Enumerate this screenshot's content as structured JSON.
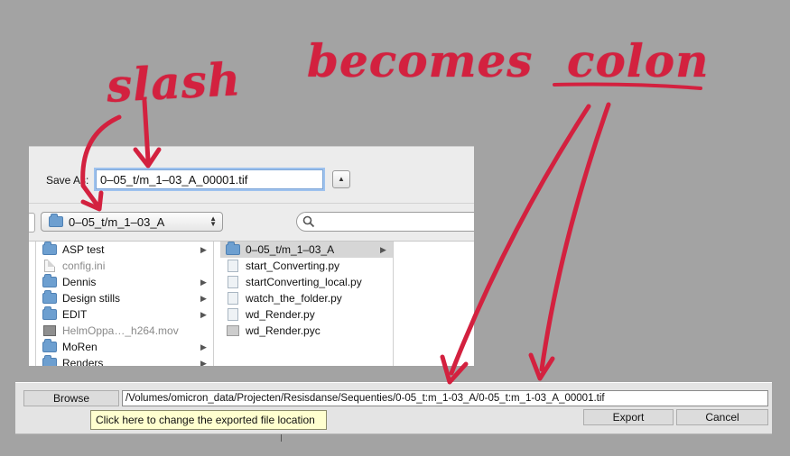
{
  "annotation": {
    "words": [
      "slash",
      "becomes",
      "colon"
    ],
    "color": "#d3213f"
  },
  "save_dialog": {
    "save_as_label": "Save As:",
    "filename_value": "0–05_t/m_1–03_A_00001.tif",
    "expand_button_glyph": "▲",
    "path_popup_label": "0–05_t/m_1–03_A",
    "popup_arrows": "▲▼",
    "search_icon": "magnifier-icon",
    "column_left": [
      {
        "name": "ASP test",
        "kind": "folder",
        "has_children": true
      },
      {
        "name": "config.ini",
        "kind": "file",
        "has_children": false,
        "dim": true
      },
      {
        "name": "Dennis",
        "kind": "folder",
        "has_children": true
      },
      {
        "name": "Design stills",
        "kind": "folder",
        "has_children": true
      },
      {
        "name": "EDIT",
        "kind": "folder",
        "has_children": true
      },
      {
        "name": "HelmOppa…_h264.mov",
        "kind": "media",
        "has_children": false,
        "dim": true
      },
      {
        "name": "MoRen",
        "kind": "folder",
        "has_children": true
      },
      {
        "name": "Renders",
        "kind": "folder",
        "has_children": true
      }
    ],
    "column_mid": [
      {
        "name": "0–05_t/m_1–03_A",
        "kind": "folder",
        "has_children": true,
        "selected": true
      },
      {
        "name": "start_Converting.py",
        "kind": "py",
        "has_children": false
      },
      {
        "name": "startConverting_local.py",
        "kind": "py",
        "has_children": false
      },
      {
        "name": "watch_the_folder.py",
        "kind": "py",
        "has_children": false
      },
      {
        "name": "wd_Render.py",
        "kind": "py",
        "has_children": false
      },
      {
        "name": "wd_Render.pyc",
        "kind": "pyc",
        "has_children": false
      }
    ],
    "chevron_glyph": "▶"
  },
  "export_panel": {
    "browse_label": "Browse",
    "path_value": "/Volumes/omicron_data/Projecten/Resisdanse/Sequenties/0-05_t:m_1-03_A/0-05_t:m_1-03_A_00001.tif",
    "tooltip": "Click here to change the exported file location",
    "export_label": "Export",
    "cancel_label": "Cancel"
  }
}
